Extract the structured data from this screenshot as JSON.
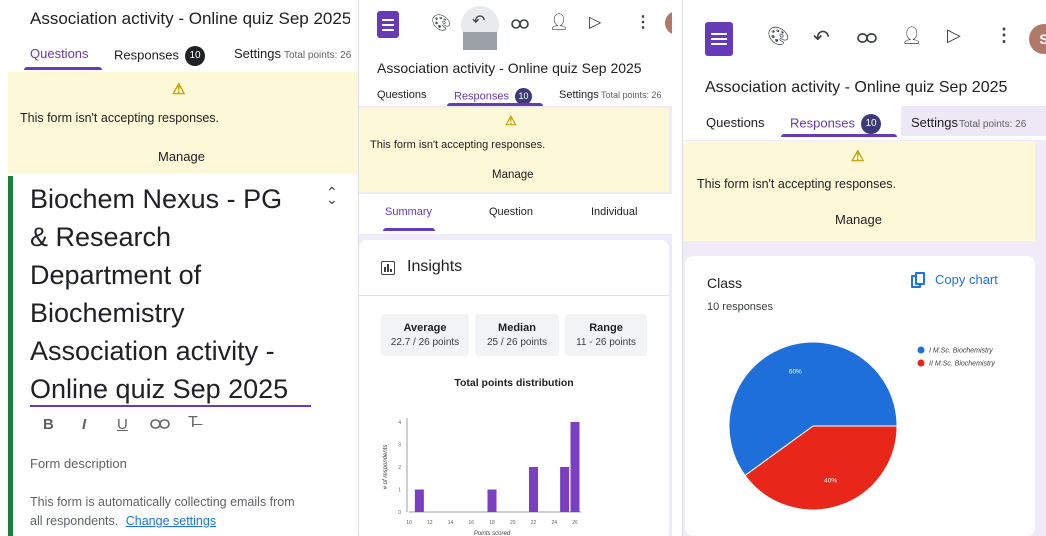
{
  "form_title": "Association activity - Online quiz Sep 2025",
  "tabs": {
    "questions": "Questions",
    "responses": "Responses",
    "responses_count": "10",
    "settings": "Settings",
    "total_points": "Total points: 26"
  },
  "banner": {
    "message": "This form isn't accepting responses.",
    "manage": "Manage"
  },
  "panel1": {
    "heading_lines": [
      "Biochem Nexus - PG",
      "& Research",
      "Department of",
      "Biochemistry",
      "Association activity -",
      "Online quiz Sep 2025"
    ],
    "format_buttons": {
      "bold": "B",
      "italic": "I",
      "underline": "U"
    },
    "description_placeholder": "Form description",
    "email_notice": "This form is automatically collecting emails from",
    "email_notice_2": "all respondents.",
    "change_settings": "Change settings"
  },
  "panel2": {
    "subtabs": [
      "Summary",
      "Question",
      "Individual"
    ],
    "insights_title": "Insights",
    "stats": [
      {
        "label": "Average",
        "value": "22.7 / 26 points"
      },
      {
        "label": "Median",
        "value": "25 / 26 points"
      },
      {
        "label": "Range",
        "value": "11 - 26 points"
      }
    ]
  },
  "panel3": {
    "card_title": "Class",
    "copy_chart": "Copy chart",
    "responses_count": "10 responses"
  },
  "avatar_letter": "S",
  "colors": {
    "accent": "#673ab7",
    "banner": "#fcf8d8",
    "bar": "#7b3fc4",
    "pie_blue": "#1e6fd9",
    "pie_red": "#e8271a",
    "link": "#1a73e8"
  },
  "icons": [
    "forms-logo-icon",
    "palette-icon",
    "undo-icon",
    "link-icon",
    "add-collaborator-icon",
    "preview-icon",
    "more-vert-icon",
    "collapse-icon",
    "insights-icon",
    "copy-chart-icon",
    "link-format-icon",
    "clear-format-icon"
  ],
  "chart_data": [
    {
      "type": "bar",
      "title": "Total points distribution",
      "xlabel": "Points scored",
      "ylabel": "# of respondents",
      "categories": [
        "10",
        "12",
        "14",
        "16",
        "18",
        "20",
        "22",
        "24",
        "26"
      ],
      "x": [
        11,
        18,
        22,
        25,
        26
      ],
      "values": [
        1,
        1,
        2,
        2,
        4
      ],
      "ylim": [
        0,
        4
      ],
      "yticks": [
        "0",
        "1",
        "2",
        "3",
        "4"
      ]
    },
    {
      "type": "pie",
      "labels": [
        "I M.Sc. Biochemistry",
        "II M.Sc. Biochemistry"
      ],
      "values": [
        60,
        40
      ],
      "slice_labels": [
        "60%",
        "40%"
      ],
      "legend": "right"
    }
  ]
}
